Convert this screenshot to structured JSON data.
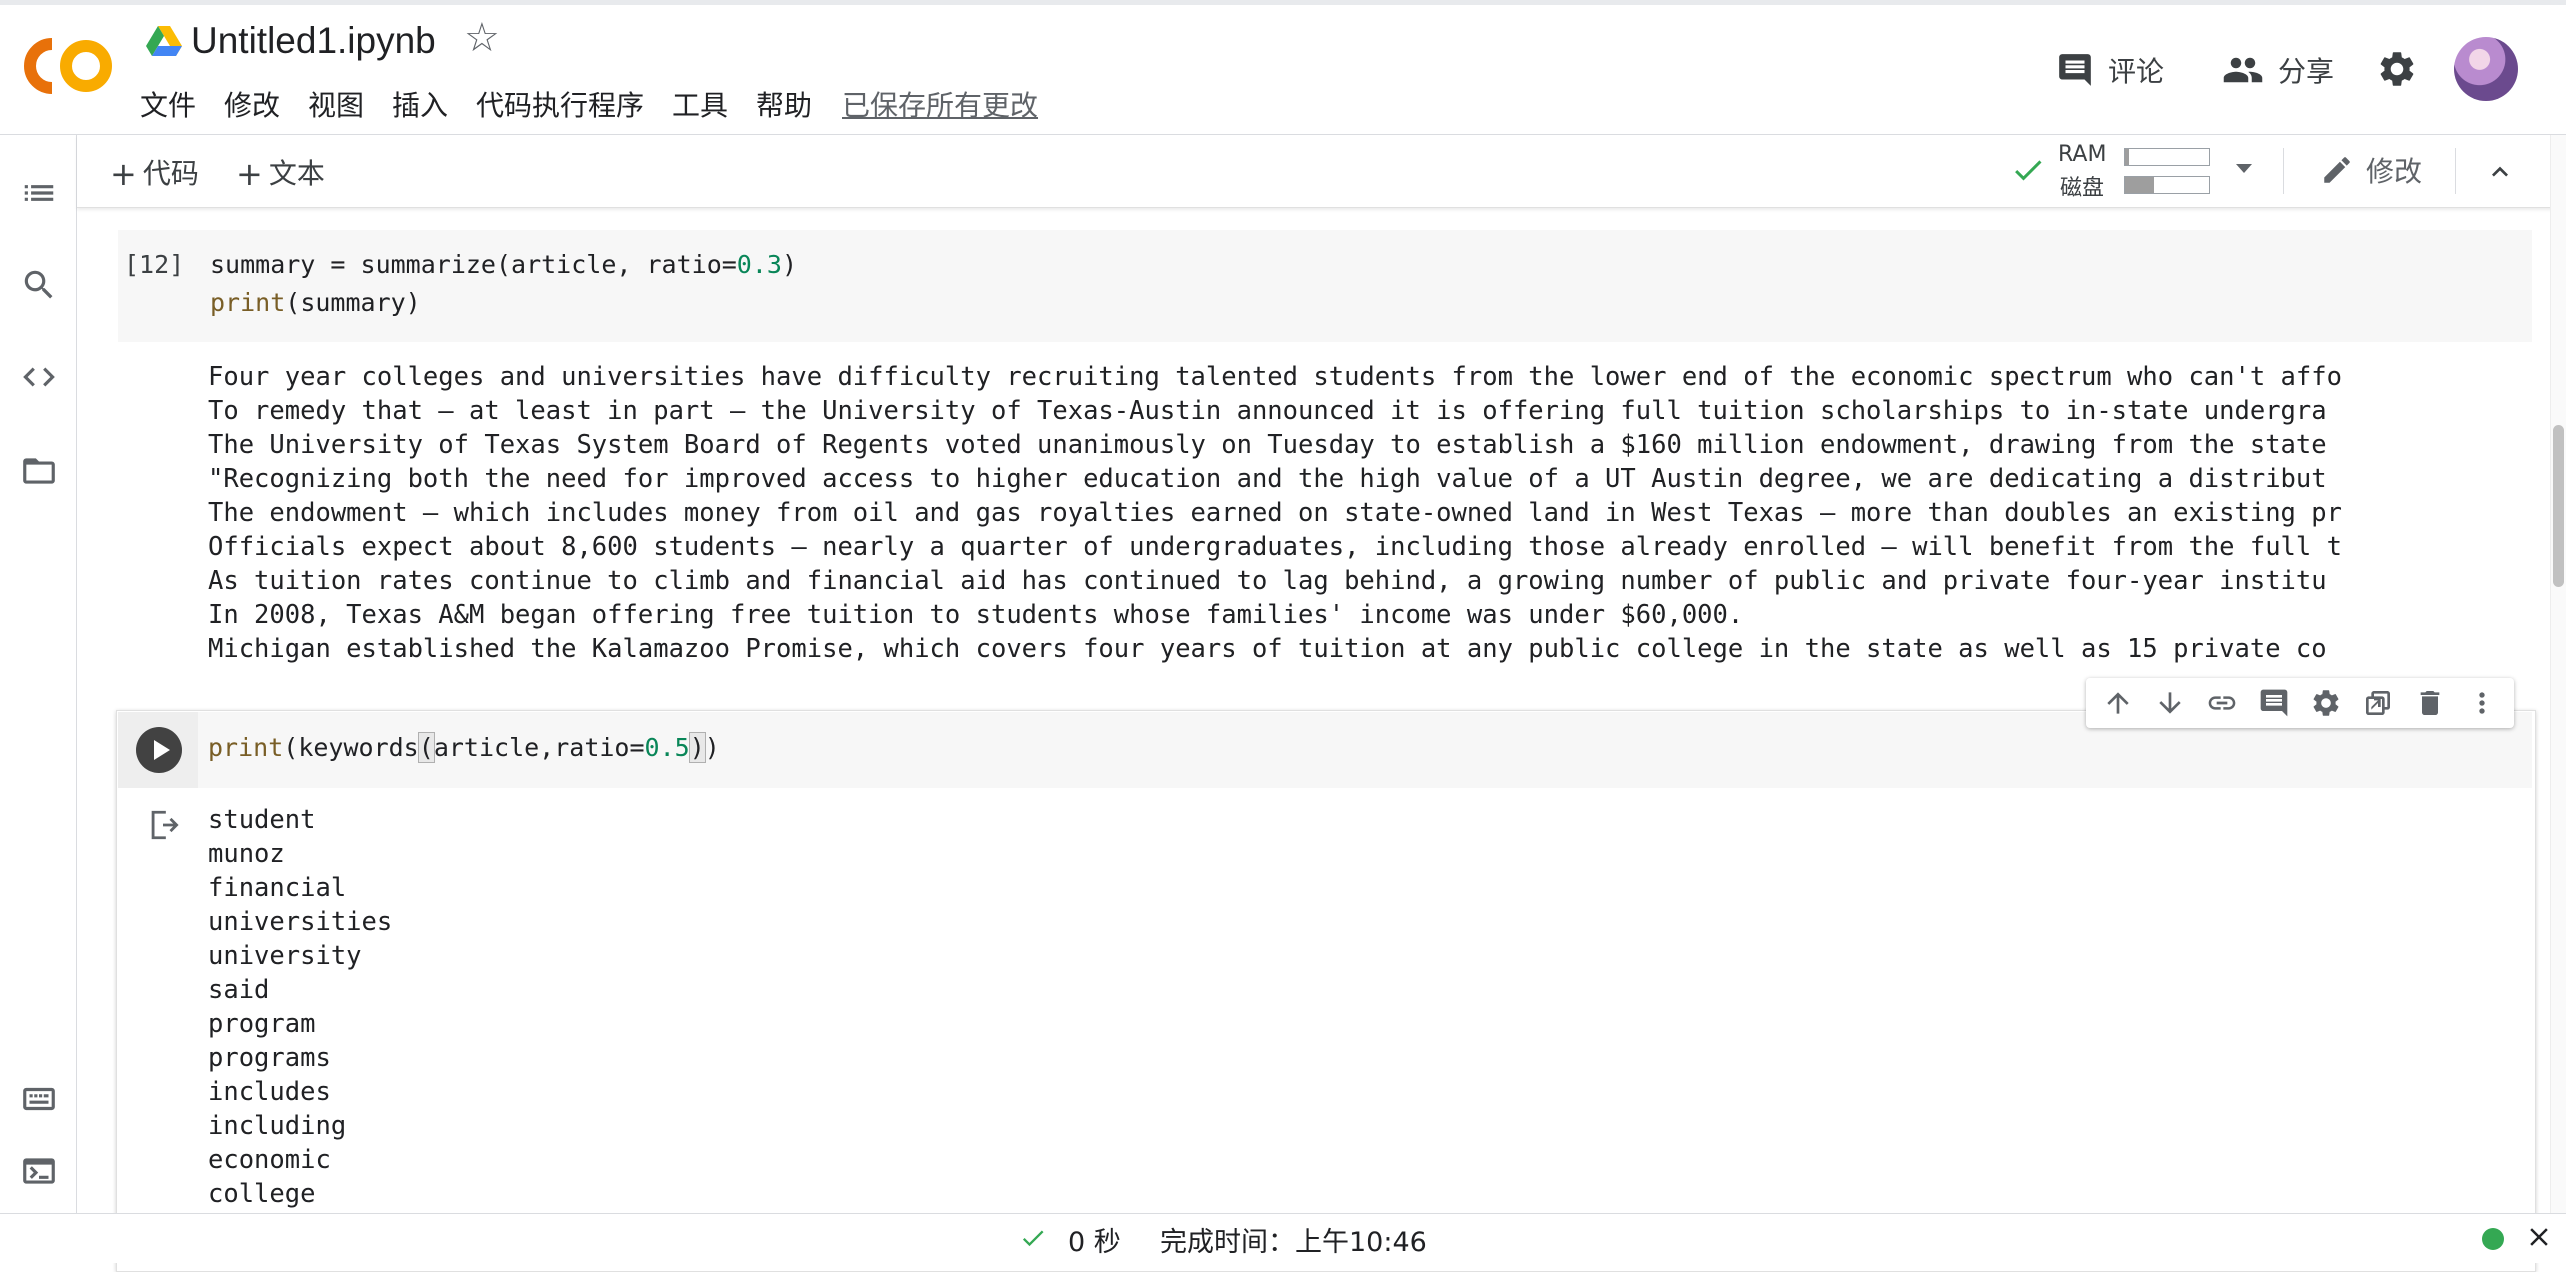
{
  "header": {
    "notebook_title": "Untitled1.ipynb",
    "menus": [
      "文件",
      "修改",
      "视图",
      "插入",
      "代码执行程序",
      "工具",
      "帮助"
    ],
    "save_status": "已保存所有更改",
    "comment_label": "评论",
    "share_label": "分享"
  },
  "toolbar": {
    "add_code_label": "代码",
    "add_text_label": "文本",
    "ram_label": "RAM",
    "disk_label": "磁盘",
    "ram_usage": 0.05,
    "disk_usage": 0.35,
    "edit_label": "修改"
  },
  "cells": [
    {
      "execution_count": "[12]",
      "code": [
        "summary = summarize(article, ratio=0.3)",
        "print(summary)"
      ],
      "output": [
        "Four year colleges and universities have difficulty recruiting talented students from the lower end of the economic spectrum who can't affo",
        "To remedy that — at least in part — the University of Texas-Austin announced it is offering full tuition scholarships to in-state undergra",
        "The University of Texas System Board of Regents voted unanimously on Tuesday to establish a $160 million endowment, drawing from the state",
        "\"Recognizing both the need for improved access to higher education and the high value of a UT Austin degree, we are dedicating a distribut",
        "The endowment — which includes money from oil and gas royalties earned on state-owned land in West Texas — more than doubles an existing pr",
        "Officials expect about 8,600 students — nearly a quarter of undergraduates, including those already enrolled — will benefit from the full t",
        "As tuition rates continue to climb and financial aid has continued to lag behind, a growing number of public and private four-year institu",
        "In 2008, Texas A&M began offering free tuition to students whose families' income was under $60,000.",
        "Michigan established the Kalamazoo Promise, which covers four years of tuition at any public college in the state as well as 15 private co"
      ]
    },
    {
      "code_fn": "print",
      "code_mid": "keywords",
      "code_args": "article,ratio=",
      "code_num": "0.5",
      "output": [
        "student",
        "munoz",
        "financial",
        "universities",
        "university",
        "said",
        "program",
        "programs",
        "includes",
        "including",
        "economic",
        "college"
      ]
    }
  ],
  "status_bar": {
    "duration": "0 秒",
    "completed": "完成时间：上午10:46"
  },
  "colors": {
    "logo_orange": "#f9ab00",
    "logo_dark_orange": "#e8710a",
    "check_green": "#34a853",
    "number_green": "#098658",
    "keyword_brown": "#795e26"
  }
}
